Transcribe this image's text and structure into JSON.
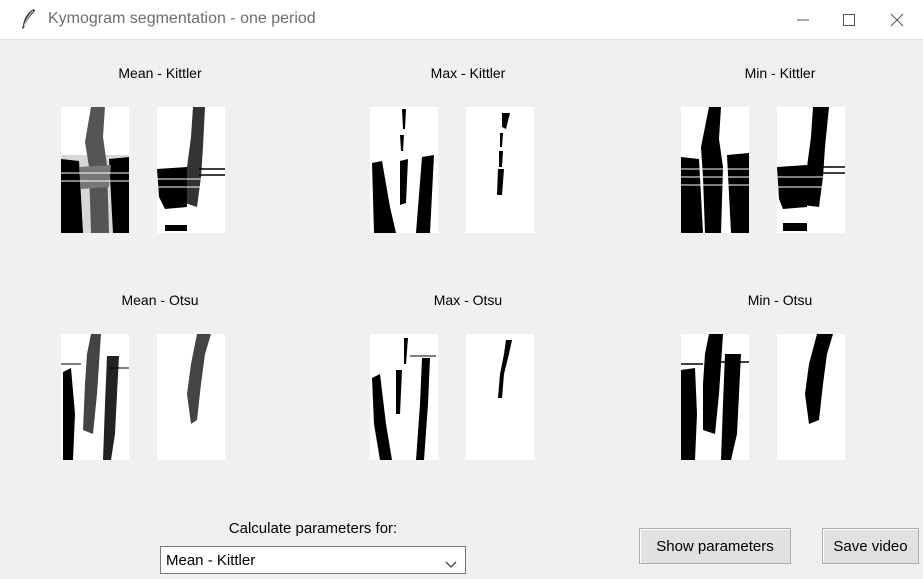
{
  "window": {
    "title": "Kymogram segmentation - one period",
    "icon": "feather-icon",
    "controls": [
      "minimize-icon",
      "maximize-icon",
      "close-icon"
    ]
  },
  "grid": {
    "mean_kittler": "Mean - Kittler",
    "max_kittler": "Max - Kittler",
    "min_kittler": "Min - Kittler",
    "mean_otsu": "Mean - Otsu",
    "max_otsu": "Max - Otsu",
    "min_otsu": "Min - Otsu"
  },
  "controls": {
    "calculate_label": "Calculate parameters for:",
    "selected": "Mean - Kittler",
    "show_parameters": "Show parameters",
    "save_video": "Save video"
  }
}
